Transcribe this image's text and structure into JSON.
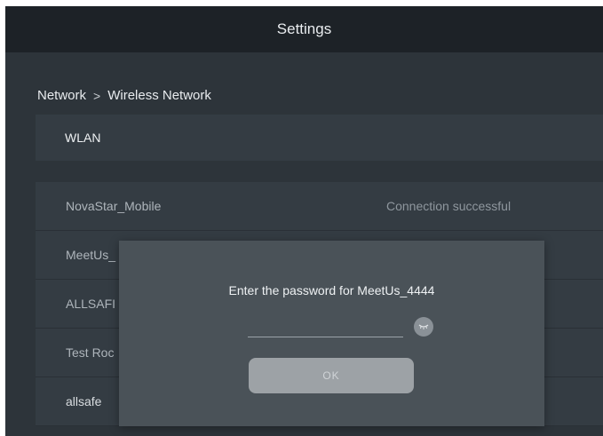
{
  "header": {
    "title": "Settings"
  },
  "breadcrumb": {
    "parent": "Network",
    "separator": ">",
    "current": "Wireless Network"
  },
  "wlan": {
    "label": "WLAN"
  },
  "networks": [
    {
      "name": "NovaStar_Mobile",
      "status": "Connection successful"
    },
    {
      "name": "MeetUs_",
      "status": ""
    },
    {
      "name": "ALLSAFI",
      "status": ""
    },
    {
      "name": "Test Roc",
      "status": ""
    },
    {
      "name": "allsafe",
      "status": ""
    }
  ],
  "dialog": {
    "message": "Enter the password for MeetUs_4444",
    "password_value": "",
    "eye_icon": "eye-closed-icon",
    "ok_label": "OK"
  },
  "colors": {
    "background": "#2d343a",
    "topbar": "#1d2227",
    "row": "#343c43",
    "dialog": "#4a5258",
    "ok_button": "#9da2a6"
  }
}
